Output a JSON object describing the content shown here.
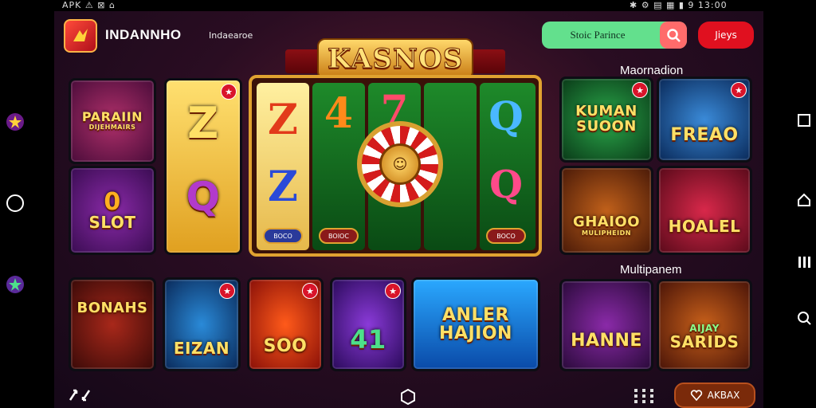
{
  "status_bar": {
    "left_text": "APK ⚠ ⊠ ⌂",
    "right_text": "✱ ⚙ ▤ ▦ ▮ 9 13:00"
  },
  "header": {
    "brand": "INDANNHO",
    "subbrand": "Indaearoe",
    "search_value": "Stoic Parince",
    "play_label": "Jieys"
  },
  "banner": {
    "title": "KASNOS"
  },
  "left_tiles": [
    {
      "label": "PARAIIN",
      "sub": "DIJEHMAIRS"
    },
    {
      "label": "SLOT",
      "sub": "0"
    }
  ],
  "reels": [
    {
      "top": "Z",
      "bottom": "Q",
      "button": ""
    },
    {
      "top": "Z",
      "bottom": "Z",
      "button": "BOCO"
    },
    {
      "top": "4",
      "bottom": "",
      "button": "BOIOC"
    },
    {
      "top": "7",
      "bottom": "",
      "button": ""
    },
    {
      "top": "Q",
      "bottom": "Q",
      "button": "BOCO"
    }
  ],
  "sections": {
    "right_top": "Maornadion",
    "right_bottom": "Multipanem"
  },
  "right_tiles": [
    {
      "label": "KUMAN SUOON"
    },
    {
      "label": "FREAO"
    },
    {
      "label": "GHAIOO",
      "sub": "MULIPHEIDN"
    },
    {
      "label": "HOALEL"
    }
  ],
  "bottom_tiles": [
    {
      "label": "BONAHS"
    },
    {
      "label": "EIZAN"
    },
    {
      "label": "SOO"
    },
    {
      "label": "41"
    },
    {
      "label": "ANLER",
      "sub": "HAJION"
    }
  ],
  "bottom_right_tiles": [
    {
      "label": "HANNE"
    },
    {
      "label": "SARIDS",
      "sub": "AIJAY"
    }
  ],
  "bottom_bar": {
    "bonus_label": "AKBAX"
  },
  "colors": {
    "accent_green": "#63e08d",
    "accent_red": "#e0101f",
    "gold": "#e0a230"
  }
}
